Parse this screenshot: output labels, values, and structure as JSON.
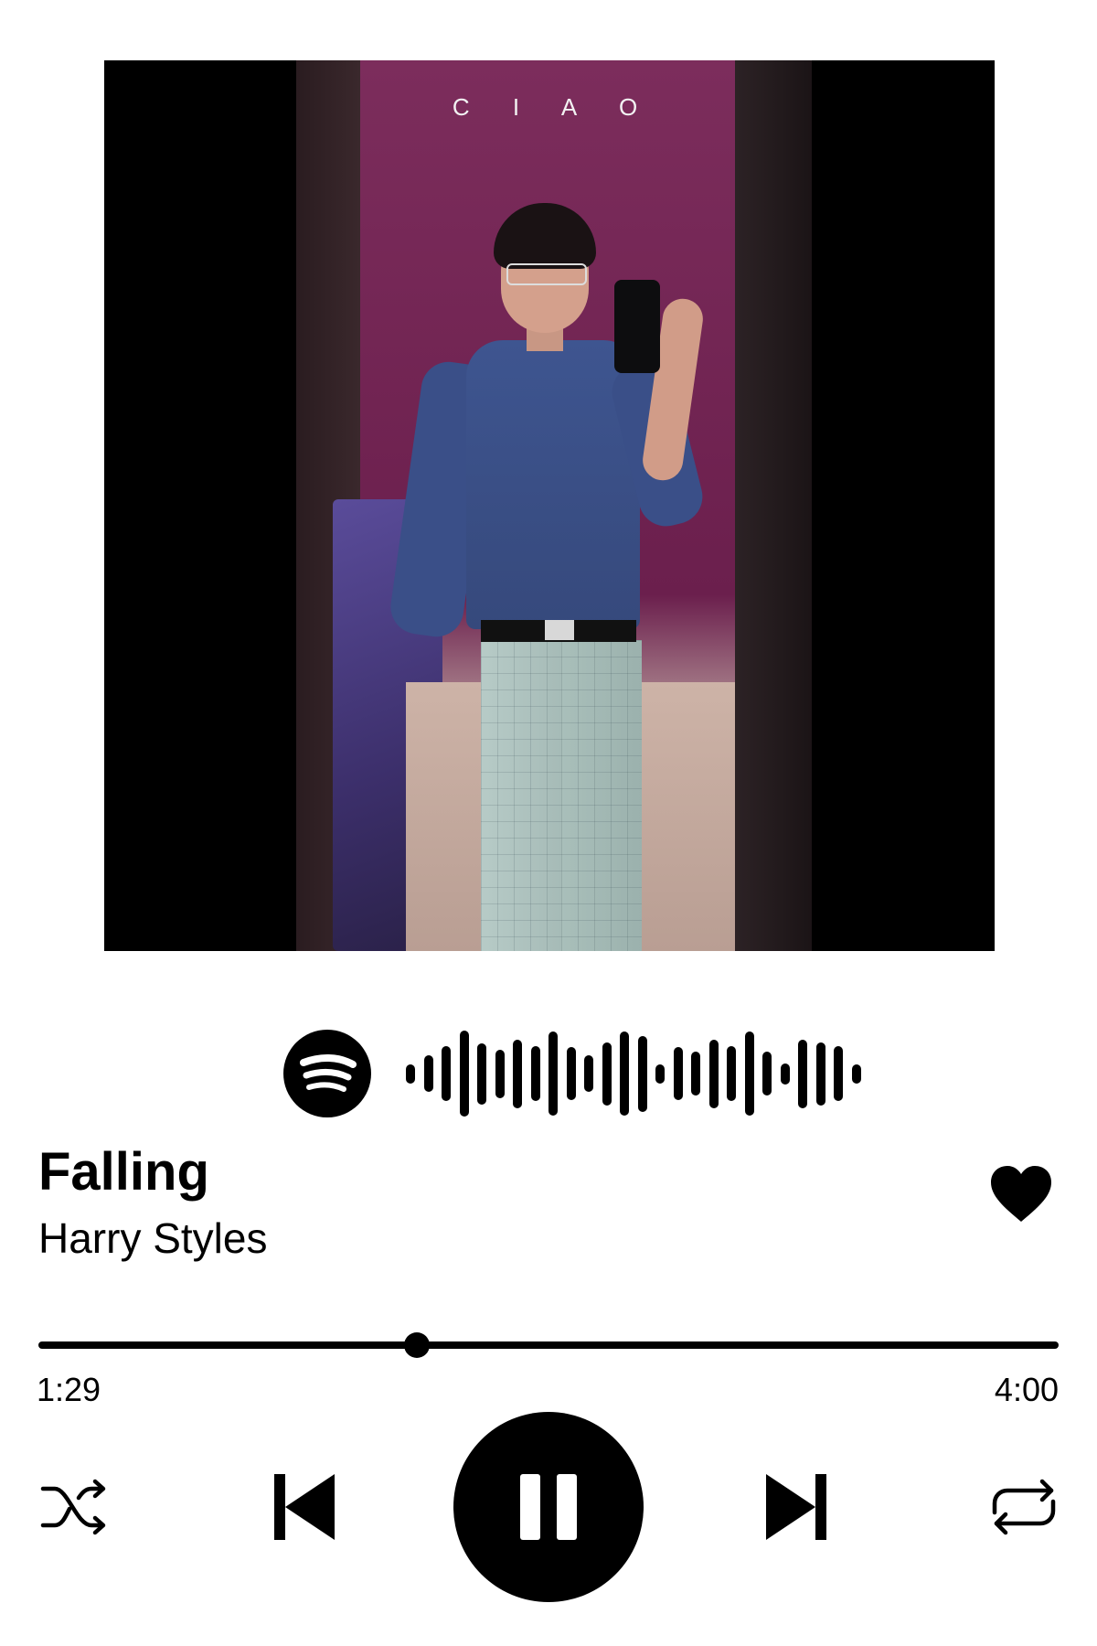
{
  "album_art": {
    "overlay_text": "C I A O"
  },
  "spotify_code": {
    "logo_icon": "spotify-icon",
    "bar_heights": [
      0.22,
      0.42,
      0.62,
      0.98,
      0.7,
      0.55,
      0.78,
      0.62,
      0.96,
      0.6,
      0.42,
      0.72,
      0.96,
      0.86,
      0.22,
      0.6,
      0.5,
      0.78,
      0.62,
      0.96,
      0.5,
      0.24,
      0.78,
      0.72,
      0.62,
      0.22
    ]
  },
  "track": {
    "title": "Falling",
    "artist": "Harry Styles",
    "liked": true
  },
  "progress": {
    "elapsed": "1:29",
    "total": "4:00",
    "fraction": 0.371
  },
  "controls": {
    "shuffle_icon": "shuffle-icon",
    "previous_icon": "skip-previous-icon",
    "play_state": "playing",
    "pause_icon": "pause-icon",
    "next_icon": "skip-next-icon",
    "repeat_icon": "repeat-icon"
  },
  "colors": {
    "background": "#ffffff",
    "foreground": "#000000"
  }
}
